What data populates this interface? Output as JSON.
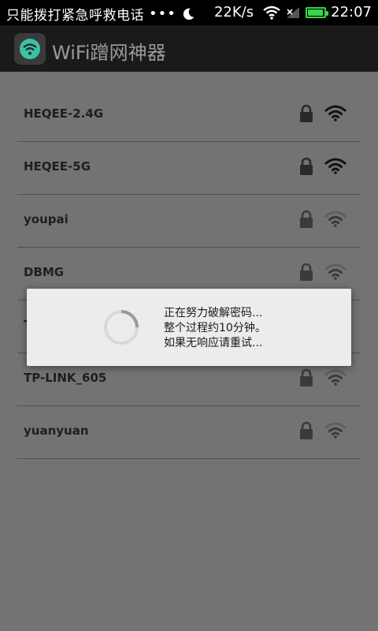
{
  "status_bar": {
    "carrier": "只能拨打紧急呼救电话",
    "dots": "•••",
    "speed": "22K/s",
    "time": "22:07",
    "battery_level": 0.95,
    "icons": [
      "moon-icon",
      "wifi-status-icon",
      "signal-icon",
      "battery-icon"
    ]
  },
  "app": {
    "title": "WiFi蹭网神器",
    "logo_icon": "wifi-logo-icon"
  },
  "networks": [
    {
      "ssid": "HEQEE-2.4G",
      "locked": true,
      "signal": "strong"
    },
    {
      "ssid": "HEQEE-5G",
      "locked": true,
      "signal": "strong"
    },
    {
      "ssid": "youpai",
      "locked": true,
      "signal": "weak"
    },
    {
      "ssid": "DBMG",
      "locked": true,
      "signal": "weak"
    },
    {
      "ssid": "T",
      "locked": true,
      "signal": "weak"
    },
    {
      "ssid": "TP-LINK_605",
      "locked": true,
      "signal": "weak"
    },
    {
      "ssid": "yuanyuan",
      "locked": true,
      "signal": "weak"
    }
  ],
  "dialog": {
    "line1": "正在努力破解密码...",
    "line2": "整个过程约10分钟。",
    "line3": "如果无响应请重试..."
  },
  "colors": {
    "strong_wifi": "#111111",
    "weak_wifi": "#3a3a3a",
    "battery": "#3ad34a",
    "logo_ring": "#38c4a4"
  }
}
